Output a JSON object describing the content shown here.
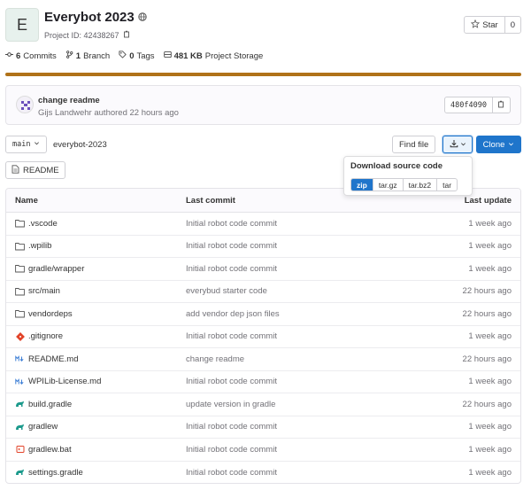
{
  "project": {
    "avatar_letter": "E",
    "name": "Everybot 2023",
    "id_text": "Project ID: 42438267",
    "star_label": "Star",
    "star_count": "0"
  },
  "stats": {
    "commits_count": "6",
    "commits_label": "Commits",
    "branches_count": "1",
    "branches_label": "Branch",
    "tags_count": "0",
    "tags_label": "Tags",
    "storage_size": "481 KB",
    "storage_label": "Project Storage"
  },
  "language_bar": {
    "color": "#b07219"
  },
  "last_commit": {
    "title": "change readme",
    "meta": "Gijs Landwehr authored 22 hours ago",
    "sha": "480f4090"
  },
  "toolbar": {
    "branch": "main",
    "breadcrumb": "everybot-2023",
    "find_file": "Find file",
    "clone": "Clone",
    "readme": "README"
  },
  "download": {
    "title": "Download source code",
    "options": [
      "zip",
      "tar.gz",
      "tar.bz2",
      "tar"
    ],
    "selected": "zip"
  },
  "table": {
    "headers": {
      "name": "Name",
      "commit": "Last commit",
      "update": "Last update"
    },
    "rows": [
      {
        "icon": "folder-icon",
        "name": ".vscode",
        "commit": "Initial robot code commit",
        "update": "1 week ago"
      },
      {
        "icon": "folder-icon",
        "name": ".wpilib",
        "commit": "Initial robot code commit",
        "update": "1 week ago"
      },
      {
        "icon": "folder-icon",
        "name": "gradle/wrapper",
        "commit": "Initial robot code commit",
        "update": "1 week ago"
      },
      {
        "icon": "folder-icon",
        "name": "src/main",
        "commit": "everybud starter code",
        "update": "22 hours ago"
      },
      {
        "icon": "folder-icon",
        "name": "vendordeps",
        "commit": "add vendor dep json files",
        "update": "22 hours ago"
      },
      {
        "icon": "git-icon",
        "name": ".gitignore",
        "commit": "Initial robot code commit",
        "update": "1 week ago"
      },
      {
        "icon": "markdown-icon",
        "name": "README.md",
        "commit": "change readme",
        "update": "22 hours ago"
      },
      {
        "icon": "markdown-icon",
        "name": "WPILib-License.md",
        "commit": "Initial robot code commit",
        "update": "1 week ago"
      },
      {
        "icon": "gradle-icon",
        "name": "build.gradle",
        "commit": "update version in gradle",
        "update": "22 hours ago"
      },
      {
        "icon": "gradle-icon",
        "name": "gradlew",
        "commit": "Initial robot code commit",
        "update": "1 week ago"
      },
      {
        "icon": "batch-icon",
        "name": "gradlew.bat",
        "commit": "Initial robot code commit",
        "update": "1 week ago"
      },
      {
        "icon": "gradle-icon",
        "name": "settings.gradle",
        "commit": "Initial robot code commit",
        "update": "1 week ago"
      }
    ]
  }
}
